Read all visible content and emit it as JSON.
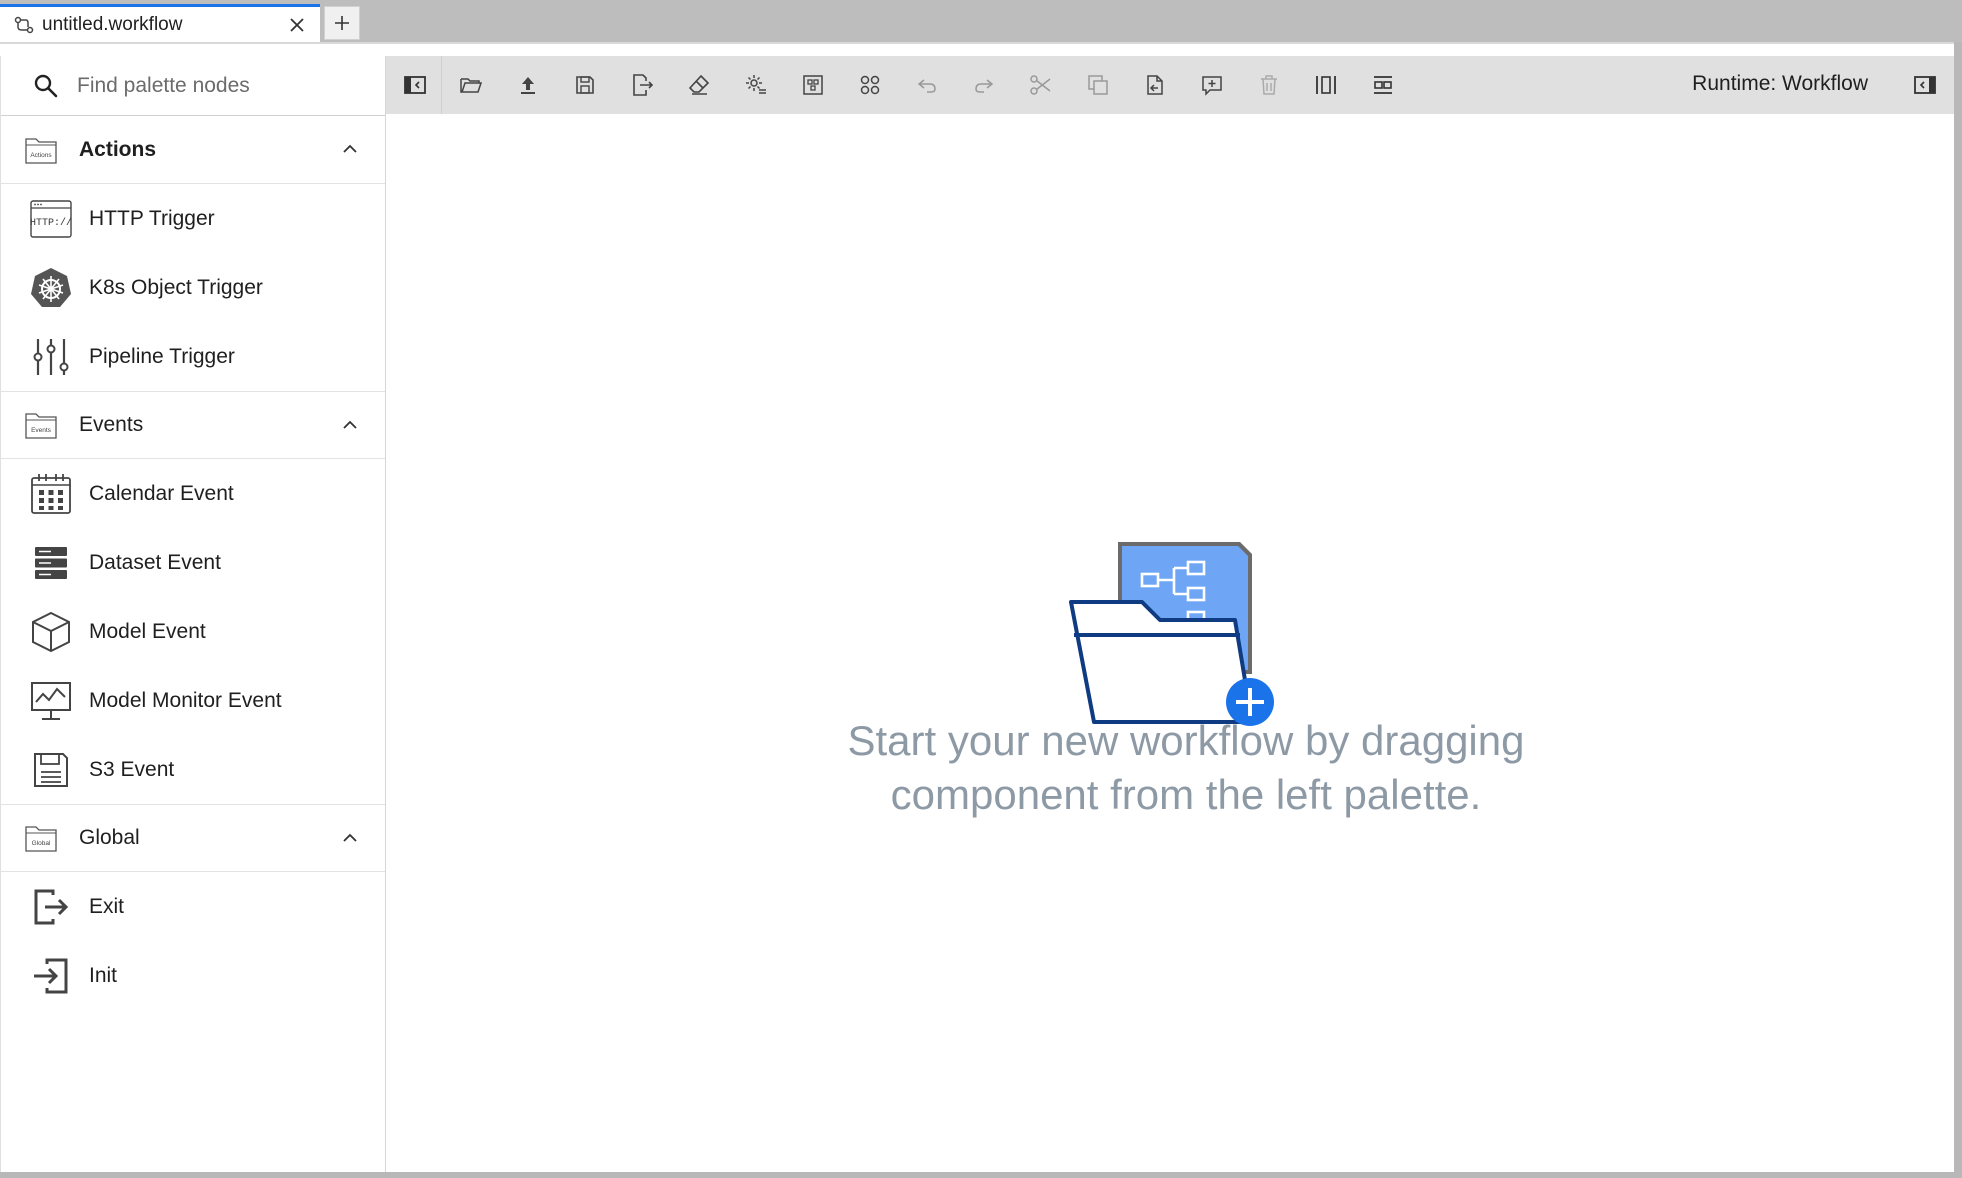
{
  "tab": {
    "title": "untitled.workflow",
    "close_icon": "close-icon",
    "new_tab_icon": "plus-icon"
  },
  "palette": {
    "search_placeholder": "Find palette nodes",
    "categories": [
      {
        "label": "Actions",
        "folder_tag": "Actions",
        "expanded": true,
        "nodes": [
          {
            "label": "HTTP Trigger",
            "icon": "http-icon"
          },
          {
            "label": "K8s Object Trigger",
            "icon": "kubernetes-icon"
          },
          {
            "label": "Pipeline Trigger",
            "icon": "sliders-icon"
          }
        ]
      },
      {
        "label": "Events",
        "folder_tag": "Events",
        "expanded": true,
        "nodes": [
          {
            "label": "Calendar Event",
            "icon": "calendar-icon"
          },
          {
            "label": "Dataset Event",
            "icon": "database-icon"
          },
          {
            "label": "Model Event",
            "icon": "cube-icon"
          },
          {
            "label": "Model Monitor Event",
            "icon": "monitor-chart-icon"
          },
          {
            "label": "S3 Event",
            "icon": "floppy-icon"
          }
        ]
      },
      {
        "label": "Global",
        "folder_tag": "Global",
        "expanded": true,
        "nodes": [
          {
            "label": "Exit",
            "icon": "exit-icon"
          },
          {
            "label": "Init",
            "icon": "enter-icon"
          }
        ]
      }
    ]
  },
  "toolbar": {
    "runtime_label": "Runtime: Workflow"
  },
  "canvas": {
    "empty_line1": "Start your new workflow by dragging",
    "empty_line2": "component from the left palette."
  },
  "colors": {
    "accent": "#1a73e8",
    "empty_text": "#8d9aa5",
    "toolbar_bg": "#e0e0e0"
  }
}
